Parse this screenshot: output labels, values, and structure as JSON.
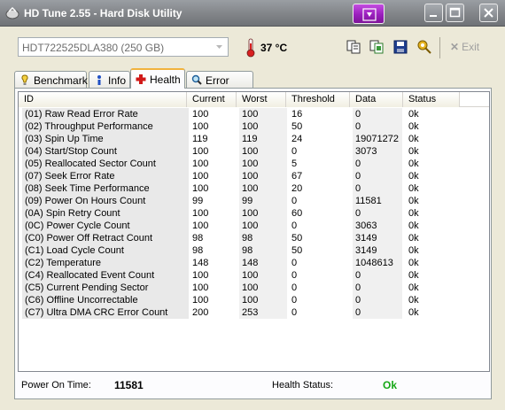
{
  "window": {
    "title": "HD Tune 2.55 - Hard Disk Utility",
    "minimize": "–",
    "maximize": "□",
    "close": "✕"
  },
  "toolbar": {
    "drive": "HDT722525DLA380 (250 GB)",
    "temperature": "37 °C",
    "exit_label": "Exit"
  },
  "tabs": [
    {
      "label": "Benchmark",
      "icon": "benchmark-icon"
    },
    {
      "label": "Info",
      "icon": "info-icon"
    },
    {
      "label": "Health",
      "icon": "health-cross-icon",
      "active": true
    },
    {
      "label": "Error Scan",
      "icon": "magnifier-icon"
    }
  ],
  "table": {
    "columns": [
      "ID",
      "Current",
      "Worst",
      "Threshold",
      "Data",
      "Status"
    ],
    "rows": [
      [
        "(01) Raw Read Error Rate",
        "100",
        "100",
        "16",
        "0",
        "0k"
      ],
      [
        "(02) Throughput Performance",
        "100",
        "100",
        "50",
        "0",
        "0k"
      ],
      [
        "(03) Spin Up Time",
        "119",
        "119",
        "24",
        "19071272",
        "0k"
      ],
      [
        "(04) Start/Stop Count",
        "100",
        "100",
        "0",
        "3073",
        "0k"
      ],
      [
        "(05) Reallocated Sector Count",
        "100",
        "100",
        "5",
        "0",
        "0k"
      ],
      [
        "(07) Seek Error Rate",
        "100",
        "100",
        "67",
        "0",
        "0k"
      ],
      [
        "(08) Seek Time Performance",
        "100",
        "100",
        "20",
        "0",
        "0k"
      ],
      [
        "(09) Power On Hours Count",
        "99",
        "99",
        "0",
        "11581",
        "0k"
      ],
      [
        "(0A) Spin Retry Count",
        "100",
        "100",
        "60",
        "0",
        "0k"
      ],
      [
        "(0C) Power Cycle Count",
        "100",
        "100",
        "0",
        "3063",
        "0k"
      ],
      [
        "(C0) Power Off Retract Count",
        "98",
        "98",
        "50",
        "3149",
        "0k"
      ],
      [
        "(C1) Load Cycle Count",
        "98",
        "98",
        "50",
        "3149",
        "0k"
      ],
      [
        "(C2) Temperature",
        "148",
        "148",
        "0",
        "1048613",
        "0k"
      ],
      [
        "(C4) Reallocated Event Count",
        "100",
        "100",
        "0",
        "0",
        "0k"
      ],
      [
        "(C5) Current Pending Sector",
        "100",
        "100",
        "0",
        "0",
        "0k"
      ],
      [
        "(C6) Offline Uncorrectable",
        "100",
        "100",
        "0",
        "0",
        "0k"
      ],
      [
        "(C7) Ultra DMA CRC Error Count",
        "200",
        "253",
        "0",
        "0",
        "0k"
      ]
    ]
  },
  "footer": {
    "power_on_label": "Power On Time:",
    "power_on_value": "11581",
    "health_label": "Health Status:",
    "health_value": "Ok",
    "health_color": "#16a816"
  }
}
